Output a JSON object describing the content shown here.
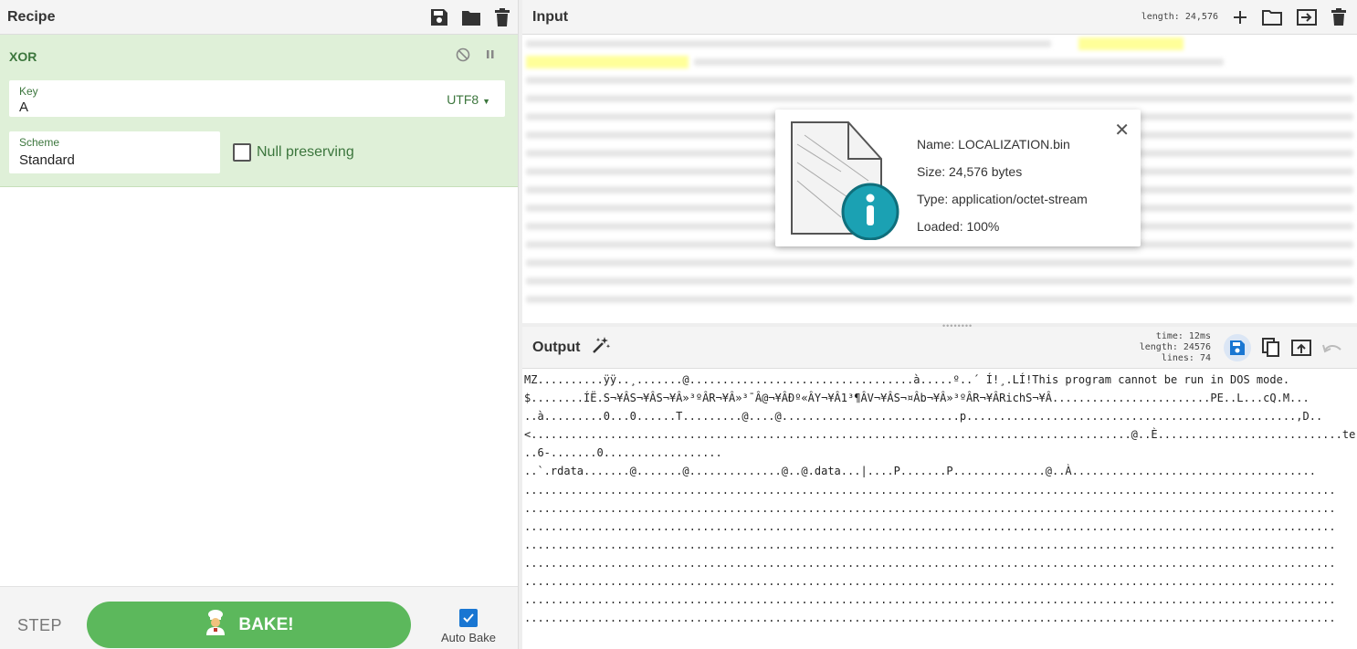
{
  "recipe": {
    "title": "Recipe",
    "icons": [
      "save-icon",
      "folder-icon",
      "trash-icon"
    ],
    "operation": {
      "name": "XOR",
      "key_label": "Key",
      "key_value": "A",
      "key_encoding": "UTF8",
      "scheme_label": "Scheme",
      "scheme_value": "Standard",
      "null_preserving_label": "Null preserving",
      "null_preserving_checked": false
    },
    "controls": {
      "step_label": "STEP",
      "bake_label": "BAKE!",
      "autobake_label": "Auto Bake",
      "autobake_checked": true
    }
  },
  "input": {
    "title": "Input",
    "length_label": "length:",
    "length_value": "24,576",
    "file": {
      "name_label": "Name:",
      "name": "LOCALIZATION.bin",
      "size_label": "Size:",
      "size": "24,576 bytes",
      "type_label": "Type:",
      "type": "application/octet-stream",
      "loaded_label": "Loaded:",
      "loaded": "100%"
    }
  },
  "output": {
    "title": "Output",
    "time_label": "time:",
    "time_value": "12ms",
    "length_label": "length:",
    "length_value": "24576",
    "lines_label": "lines:",
    "lines_value": "74",
    "lines": [
      "MZ..........ÿÿ..¸.......@..................................à.....º..´ Í!¸.LÍ!This program cannot be run in DOS mode.",
      "",
      "$........ÍË.S¬¥ÂS¬¥ÂS¬¥Â»³ºÂR¬¥Â»³¯Â@¬¥ÂÐº«ÂY¬¥Â1³¶ÂV¬¥ÂS¬¤Âb¬¥Â»³ºÂR¬¥ÂRichS¬¥Â........................PE..L...cQ.M...",
      "..à.........0...0......T.........@....@...........................p..................................................,D..",
      "<...........................................................................................@..È............................te",
      "..6-.......0..................",
      "..`.rdata.......@.......@..............@..@.data...|....P.......P..............@..À.....................................",
      "...........................................................................................................................",
      "...........................................................................................................................",
      "...........................................................................................................................",
      "...........................................................................................................................",
      "...........................................................................................................................",
      "...........................................................................................................................",
      "...........................................................................................................................",
      "..........................................................................................................................."
    ]
  }
}
